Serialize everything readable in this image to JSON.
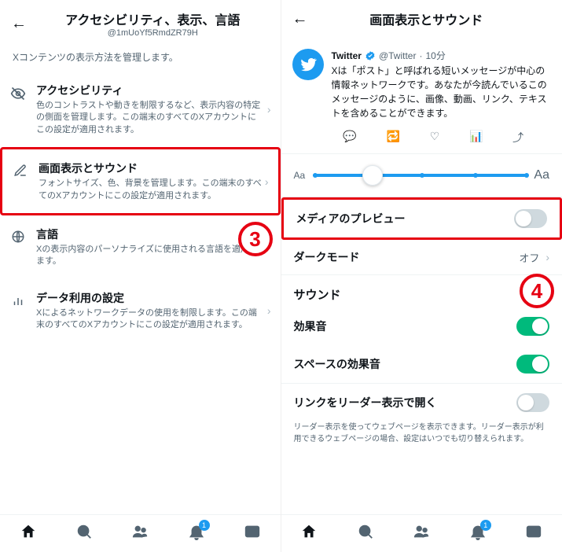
{
  "left": {
    "header": {
      "title": "アクセシビリティ、表示、言語",
      "subtitle": "@1mUoYf5RmdZR79H"
    },
    "topDesc": "Xコンテンツの表示方法を管理します。",
    "items": [
      {
        "title": "アクセシビリティ",
        "desc": "色のコントラストや動きを制限するなど、表示内容の特定の側面を管理します。この端末のすべてのXアカウントにこの設定が適用されます。"
      },
      {
        "title": "画面表示とサウンド",
        "desc": "フォントサイズ、色、背景を管理します。この端末のすべてのXアカウントにこの設定が適用されます。"
      },
      {
        "title": "言語",
        "desc": "Xの表示内容のパーソナライズに使用される言語を適用します。"
      },
      {
        "title": "データ利用の設定",
        "desc": "Xによるネットワークデータの使用を制限します。この端末のすべてのXアカウントにこの設定が適用されます。"
      }
    ]
  },
  "right": {
    "header": {
      "title": "画面表示とサウンド"
    },
    "tweet": {
      "name": "Twitter",
      "handle": "@Twitter",
      "time": "10分",
      "text": "Xは「ポスト」と呼ばれる短いメッセージが中心の情報ネットワークです。あなたが今読んでいるこのメッセージのように、画像、動画、リンク、テキストを含めることができます。"
    },
    "slider": {
      "smallLabel": "Aa",
      "largeLabel": "Aa"
    },
    "settings": {
      "mediaPreview": {
        "label": "メディアのプレビュー"
      },
      "darkMode": {
        "label": "ダークモード",
        "value": "オフ"
      },
      "soundSection": "サウンド",
      "soundEffect": {
        "label": "効果音"
      },
      "spaceSound": {
        "label": "スペースの効果音"
      },
      "readerLink": {
        "label": "リンクをリーダー表示で開く"
      },
      "readerHint": "リーダー表示を使ってウェブページを表示できます。リーダー表示が利用できるウェブページの場合、設定はいつでも切り替えられます。"
    }
  },
  "callouts": {
    "c3": "3",
    "c4": "4"
  },
  "nav": {
    "badge": "1"
  }
}
